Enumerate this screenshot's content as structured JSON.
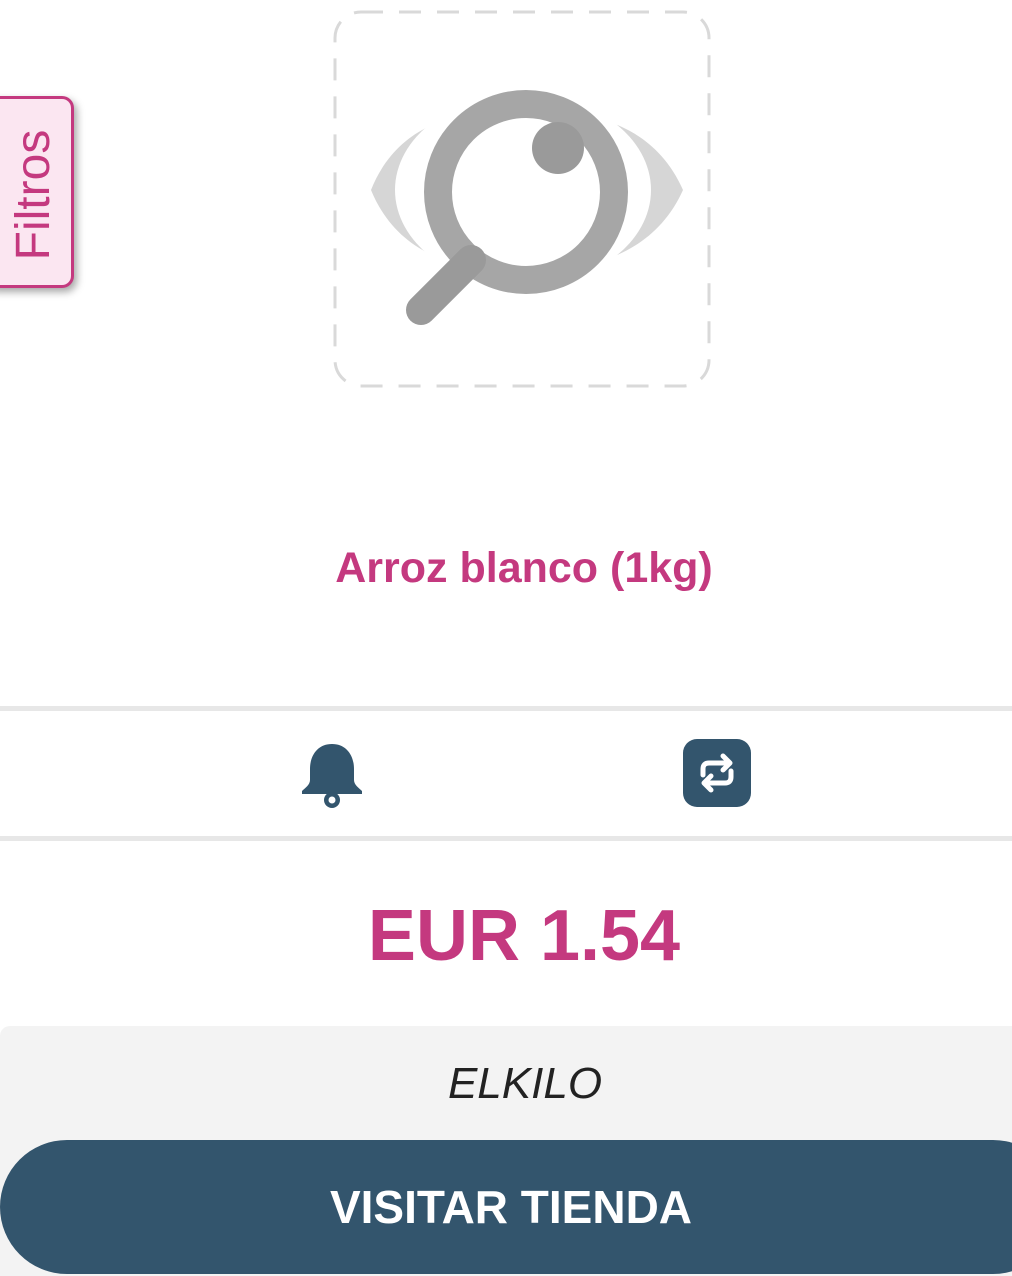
{
  "filters_tab": {
    "label": "Filtros"
  },
  "product": {
    "image": "no-image-placeholder",
    "title": "Arroz blanco (1kg)"
  },
  "actions": {
    "alert_icon": "bell-icon",
    "compare_icon": "repeat-icon"
  },
  "price": {
    "text": "EUR 1.54"
  },
  "store": {
    "name": "ELKILO",
    "visit_label": "VISITAR TIENDA"
  },
  "colors": {
    "accent": "#c4397f",
    "primary_dark": "#33556d",
    "panel_bg": "#f3f3f3",
    "divider": "#e7e7e7"
  }
}
